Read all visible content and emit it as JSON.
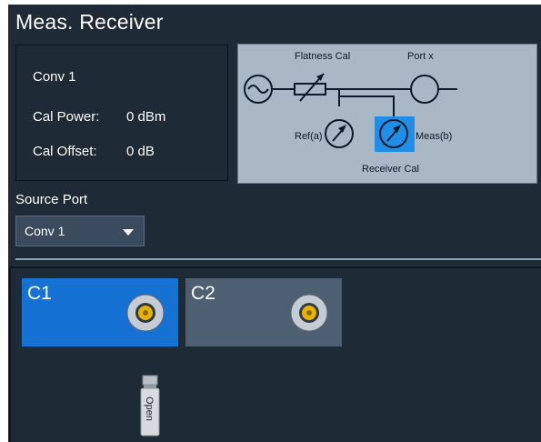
{
  "panel": {
    "title": "Meas. Receiver"
  },
  "info": {
    "standard": "Conv 1",
    "cal_power_label": "Cal Power:",
    "cal_power_value": "0 dBm",
    "cal_offset_label": "Cal Offset:",
    "cal_offset_value": "0 dB"
  },
  "diagram": {
    "flatness_cal": "Flatness Cal",
    "port": "Port x",
    "ref": "Ref(a)",
    "meas": "Meas(b)",
    "receiver_cal": "Receiver Cal"
  },
  "source_port": {
    "label": "Source Port",
    "selected": "Conv 1"
  },
  "ports": [
    {
      "label": "C1",
      "state": "selected"
    },
    {
      "label": "C2",
      "state": "unselected"
    }
  ],
  "connector_standard": {
    "label": "Open"
  },
  "colors": {
    "panel_bg": "#1e2a36",
    "diagram_bg": "#aab7c4",
    "selected_port": "#1572d4",
    "unselected_port": "#4e5f71",
    "connector_center": "#e8b200"
  }
}
